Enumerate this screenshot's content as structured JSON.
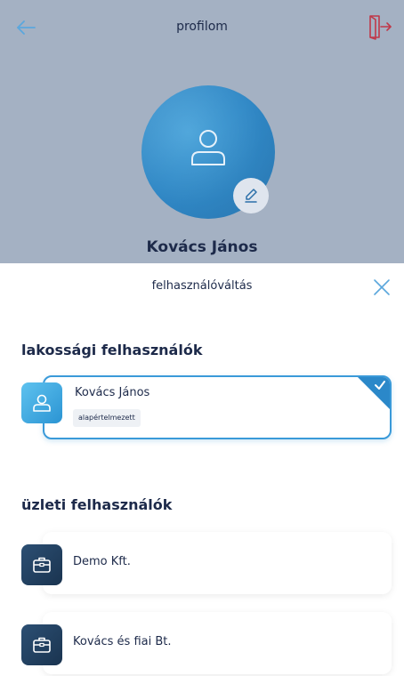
{
  "header": {
    "title": "profilom",
    "back_icon": "arrow-left-icon",
    "logout_icon": "logout-door-icon"
  },
  "profile": {
    "name": "Kovács János",
    "avatar_icon": "person-icon",
    "edit_icon": "pencil-icon"
  },
  "sheet": {
    "title": "felhasználóváltás",
    "close_icon": "close-icon",
    "sections": {
      "resident": {
        "heading": "lakossági felhasználók",
        "users": [
          {
            "name": "Kovács János",
            "badge": "alapértelmezett",
            "selected": true,
            "icon": "person-icon"
          }
        ]
      },
      "business": {
        "heading": "üzleti felhasználók",
        "users": [
          {
            "name": "Demo Kft.",
            "icon": "briefcase-icon"
          },
          {
            "name": "Kovács és fiai Bt.",
            "icon": "briefcase-icon"
          }
        ]
      }
    }
  },
  "colors": {
    "accent": "#3a9ad9",
    "logout": "#c0394a",
    "text_dark": "#1d2a4a",
    "business_icon_bg": "#1a3450"
  }
}
